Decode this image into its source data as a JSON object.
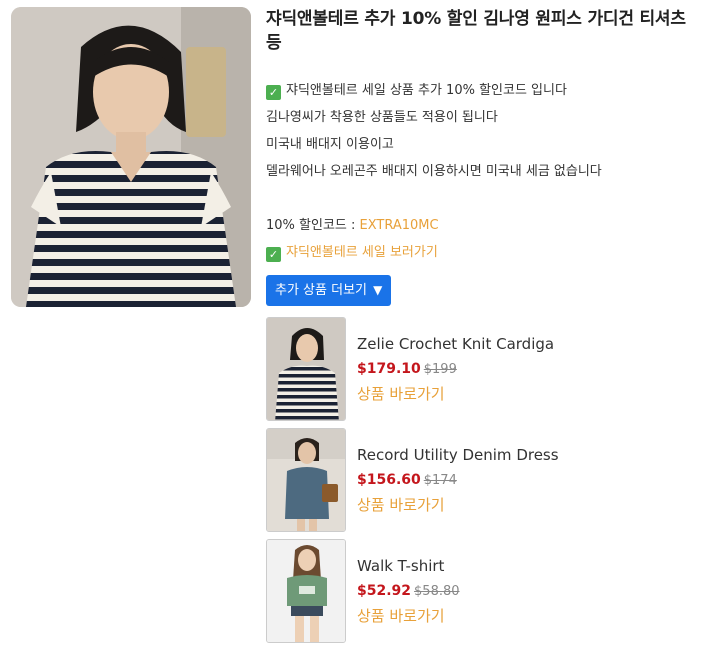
{
  "post": {
    "title": "쟈딕앤볼테르 추가 10% 할인 김나영 원피스 가디건 티셔츠 등",
    "lines": [
      "쟈딕앤볼테르 세일 상품 추가 10% 할인코드 입니다",
      "김나영씨가 착용한 상품들도 적용이 됩니다",
      "미국내 배대지 이용이고",
      "델라웨어나 오레곤주 배대지 이용하시면 미국내 세금 없습니다"
    ],
    "code_label": "10% 할인코드 : ",
    "code_value": "EXTRA10MC",
    "sale_link": "쟈딕앤볼테르 세일 보러가기",
    "more_button": "추가 상품 더보기",
    "more_arrow": "▼"
  },
  "icons": {
    "check": "check-mark-button",
    "check_color": "#4caf50"
  },
  "colors": {
    "accent": "#e8a13a",
    "button": "#1a73e8",
    "price": "#c4161c"
  },
  "products": [
    {
      "name": "Zelie Crochet Knit Cardiga",
      "price": "$179.10",
      "old_price": "$199",
      "link": "상품 바로가기"
    },
    {
      "name": "Record Utility Denim Dress",
      "price": "$156.60",
      "old_price": "$174",
      "link": "상품 바로가기"
    },
    {
      "name": "Walk T-shirt",
      "price": "$52.92",
      "old_price": "$58.80",
      "link": "상품 바로가기"
    }
  ]
}
